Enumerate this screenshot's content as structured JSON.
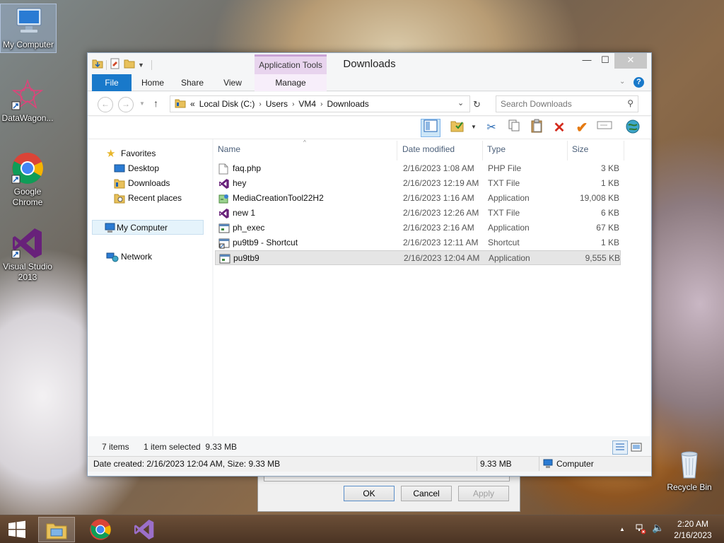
{
  "desktop": {
    "icons": [
      {
        "label": "My Computer",
        "icon": "my-computer-icon"
      },
      {
        "label": "DataWagon...",
        "icon": "datawagon-icon"
      },
      {
        "label": "Google Chrome",
        "icon": "chrome-icon"
      },
      {
        "label": "Visual Studio 2013",
        "icon": "visual-studio-icon"
      },
      {
        "label": "Recycle Bin",
        "icon": "recycle-bin-icon"
      }
    ]
  },
  "background_dialog": {
    "ok": "OK",
    "cancel": "Cancel",
    "apply": "Apply"
  },
  "window": {
    "title": "Downloads",
    "context_tab_group": "Application Tools",
    "tabs": [
      "File",
      "Home",
      "Share",
      "View",
      "Manage"
    ],
    "address": {
      "overflow": "«",
      "crumbs": [
        "Local Disk (C:)",
        "Users",
        "VM4",
        "Downloads"
      ]
    },
    "search_placeholder": "Search Downloads",
    "nav": {
      "favorites": "Favorites",
      "desktop": "Desktop",
      "downloads": "Downloads",
      "recent": "Recent places",
      "computer": "My Computer",
      "network": "Network"
    },
    "columns": {
      "name": "Name",
      "date": "Date modified",
      "type": "Type",
      "size": "Size"
    },
    "files": [
      {
        "name": "faq.php",
        "date": "2/16/2023 1:08 AM",
        "type": "PHP File",
        "size": "3 KB",
        "icon": "document-icon"
      },
      {
        "name": "hey",
        "date": "2/16/2023 12:19 AM",
        "type": "TXT File",
        "size": "1 KB",
        "icon": "visual-studio-file-icon"
      },
      {
        "name": "MediaCreationTool22H2",
        "date": "2/16/2023 1:16 AM",
        "type": "Application",
        "size": "19,008 KB",
        "icon": "setup-app-icon"
      },
      {
        "name": "new 1",
        "date": "2/16/2023 12:26 AM",
        "type": "TXT File",
        "size": "6 KB",
        "icon": "visual-studio-file-icon"
      },
      {
        "name": "ph_exec",
        "date": "2/16/2023 2:16 AM",
        "type": "Application",
        "size": "67 KB",
        "icon": "application-icon"
      },
      {
        "name": "pu9tb9 - Shortcut",
        "date": "2/16/2023 12:11 AM",
        "type": "Shortcut",
        "size": "1 KB",
        "icon": "shortcut-icon"
      },
      {
        "name": "pu9tb9",
        "date": "2/16/2023 12:04 AM",
        "type": "Application",
        "size": "9,555 KB",
        "icon": "application-icon"
      }
    ],
    "status": {
      "items": "7 items",
      "selected": "1 item selected  9.33 MB"
    },
    "details": {
      "created": "Date created: 2/16/2023 12:04 AM, Size: 9.33 MB",
      "size": "9.33 MB",
      "location": "Computer"
    }
  },
  "taskbar": {
    "time": "2:20 AM",
    "date": "2/16/2023"
  }
}
